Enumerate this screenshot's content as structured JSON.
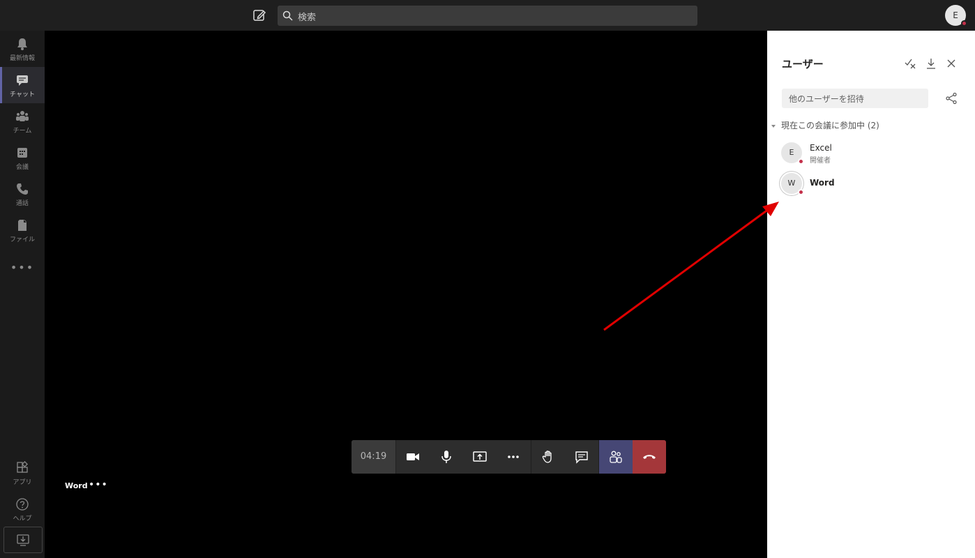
{
  "topbar": {
    "search_placeholder": "検索",
    "avatar_initial": "E"
  },
  "rail": {
    "items": [
      {
        "label": "最新情報",
        "icon": "bell-icon"
      },
      {
        "label": "チャット",
        "icon": "chat-icon",
        "active": true
      },
      {
        "label": "チーム",
        "icon": "teams-icon"
      },
      {
        "label": "会議",
        "icon": "calendar-icon"
      },
      {
        "label": "通話",
        "icon": "phone-icon"
      },
      {
        "label": "ファイル",
        "icon": "file-icon"
      }
    ],
    "more": "•••",
    "bottom": [
      {
        "label": "アプリ",
        "icon": "apps-icon"
      },
      {
        "label": "ヘルプ",
        "icon": "help-icon"
      }
    ]
  },
  "stage": {
    "tile_name": "Word",
    "tile_more": "•••"
  },
  "callbar": {
    "timer": "04:19",
    "buttons": [
      "camera-icon",
      "mic-icon",
      "share-screen-icon",
      "more-icon",
      "raise-hand-icon",
      "chat-icon",
      "people-icon",
      "hangup-icon"
    ],
    "colors": {
      "bar": "#2d2d2d",
      "people": "#464775",
      "hangup": "#a4373a"
    }
  },
  "panel": {
    "title": "ユーザー",
    "invite_placeholder": "他のユーザーを招待",
    "section_label": "現在この会議に参加中 (2)",
    "users": [
      {
        "initial": "E",
        "name": "Excel",
        "role": "開催者"
      },
      {
        "initial": "W",
        "name": "Word",
        "role": ""
      }
    ]
  },
  "colors": {
    "accent": "#6264a7",
    "status_busy": "#c4314b",
    "annotation_arrow": "#e00000"
  }
}
